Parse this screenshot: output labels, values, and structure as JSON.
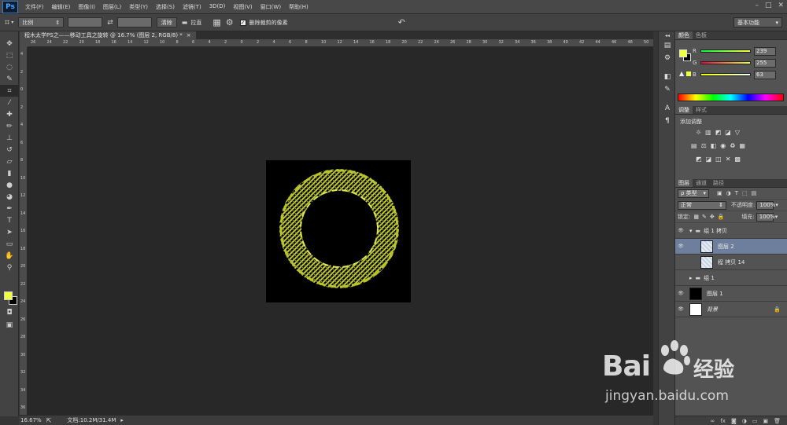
{
  "app": {
    "logo": "Ps",
    "window_controls": [
      "–",
      "□",
      "✕"
    ]
  },
  "menu": [
    "文件(F)",
    "编辑(E)",
    "图像(I)",
    "图层(L)",
    "类型(Y)",
    "选择(S)",
    "滤镜(T)",
    "3D(D)",
    "视图(V)",
    "窗口(W)",
    "帮助(H)"
  ],
  "options": {
    "ratio_select": "比例",
    "clear_btn": "清除",
    "straighten": "拉直",
    "delete_cropped_label": "删除裁剪的像素",
    "delete_cropped_checked": true,
    "workspace": "基本功能"
  },
  "document": {
    "tab_title": "程木太学PS之——移动工具之旋转 @ 16.7% (图层 2, RGB/8) *",
    "tab_close": "×"
  },
  "ruler": {
    "h_ticks": [
      "26",
      "24",
      "22",
      "20",
      "18",
      "16",
      "14",
      "12",
      "10",
      "8",
      "6",
      "4",
      "2",
      "0",
      "2",
      "4",
      "6",
      "8",
      "10",
      "12",
      "14",
      "16",
      "18",
      "20",
      "22",
      "24",
      "26",
      "28",
      "30",
      "32",
      "34",
      "36",
      "38",
      "40",
      "42",
      "44",
      "46",
      "48",
      "50"
    ],
    "v_ticks": [
      "4",
      "2",
      "0",
      "2",
      "4",
      "6",
      "8",
      "10",
      "12",
      "14",
      "16",
      "18",
      "20",
      "22",
      "24",
      "26",
      "28",
      "30",
      "32",
      "34",
      "36"
    ]
  },
  "status": {
    "zoom": "16.67%",
    "doc_info": "文档:10.2M/31.4M"
  },
  "color_panel": {
    "tabs": [
      "颜色",
      "色板"
    ],
    "foreground": "#efff3f",
    "background": "#000000",
    "channels": [
      {
        "label": "R",
        "value": "239"
      },
      {
        "label": "G",
        "value": "255"
      },
      {
        "label": "B",
        "value": "63"
      }
    ]
  },
  "adjust_panel": {
    "tabs": [
      "调整",
      "样式"
    ],
    "title": "添加调整",
    "row1": [
      "☼",
      "▥",
      "◩",
      "◪",
      "▽"
    ],
    "row2": [
      "▤",
      "⚖",
      "◧",
      "◉",
      "♻",
      "▦"
    ],
    "row3": [
      "◩",
      "◪",
      "◫",
      "✕",
      "▩"
    ]
  },
  "layers_panel": {
    "tabs": [
      "图层",
      "通道",
      "路径"
    ],
    "filter_kind": "ρ 类型",
    "blend_mode": "正常",
    "opacity_label": "不透明度:",
    "opacity": "100%",
    "lock_label": "锁定:",
    "fill_label": "填充:",
    "fill": "100%",
    "layers": [
      {
        "name": "组 1 拷贝",
        "visible": true,
        "kind": "group-open",
        "selected": false
      },
      {
        "name": "图层 2",
        "visible": true,
        "kind": "pattern",
        "selected": true
      },
      {
        "name": "程 拷贝 14",
        "visible": false,
        "kind": "pattern",
        "selected": false
      },
      {
        "name": "组 1",
        "visible": false,
        "kind": "group-closed",
        "selected": false
      },
      {
        "name": "图层 1",
        "visible": true,
        "kind": "black",
        "selected": false
      },
      {
        "name": "背景",
        "visible": true,
        "kind": "white",
        "selected": false,
        "locked": true
      }
    ],
    "bottom_icons": [
      "∞",
      "fx",
      "◙",
      "◑",
      "▭",
      "▣",
      "🗑"
    ]
  },
  "watermark": {
    "brand": "Bai",
    "brand_tail": "经验",
    "url": "jingyan.baidu.com"
  }
}
